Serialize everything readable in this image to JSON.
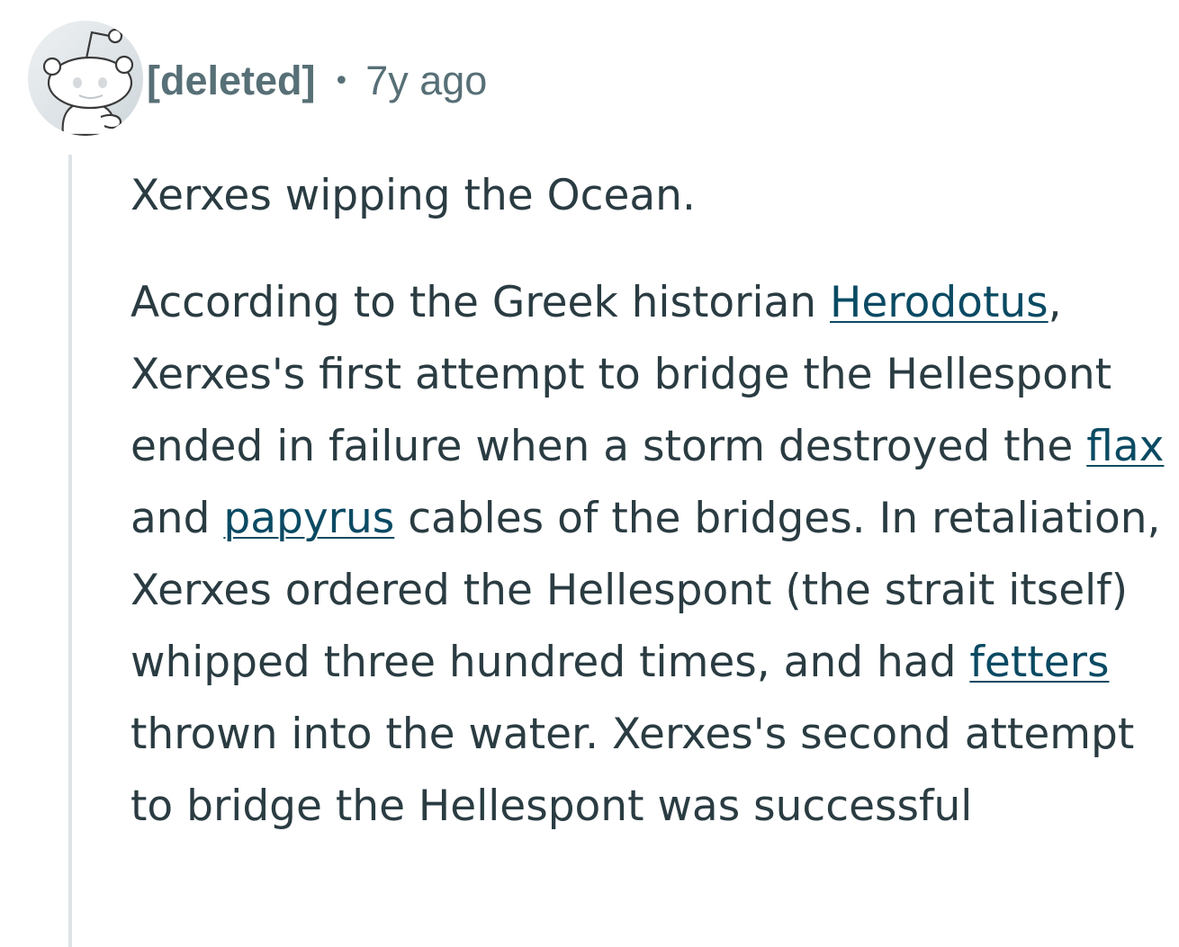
{
  "comment": {
    "author": "[deleted]",
    "separator": "•",
    "age": "7y ago",
    "avatar_icon": "snoo-avatar-icon",
    "colors": {
      "meta": "#576f76",
      "body_text": "#2a3c42",
      "link": "#0a4a63",
      "thread_line": "#dde3e7"
    },
    "body": {
      "p1": "Xerxes wipping the Ocean.",
      "p2": {
        "s1": "According to the Greek historian ",
        "link_herodotus": "Herodotus",
        "s2": ", Xerxes's first attempt to bridge the Hellespont ended in failure when a storm destroyed the ",
        "link_flax": "flax",
        "s3": " and ",
        "link_papyrus": "papyrus",
        "s4": " cables of the bridges. In retaliation, Xerxes ordered the Hellespont (the strait itself) whipped three hundred times, and had ",
        "link_fetters": "fetters",
        "s5": " thrown into the water. Xerxes's second attempt to bridge the Hellespont was successful"
      }
    }
  }
}
